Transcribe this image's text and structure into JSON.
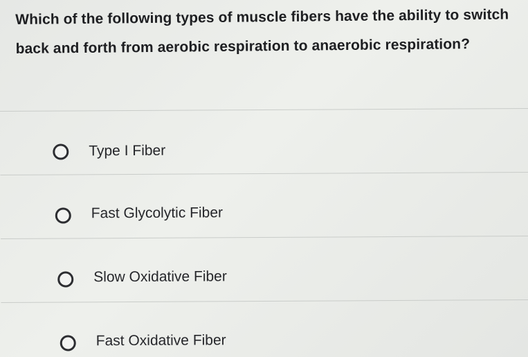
{
  "question": {
    "text": "Which of the following types of muscle fibers have the ability to switch back and forth from aerobic respiration to anaerobic respiration?"
  },
  "options": [
    {
      "label": "Type I Fiber",
      "selected": false
    },
    {
      "label": "Fast Glycolytic Fiber",
      "selected": false
    },
    {
      "label": "Slow Oxidative Fiber",
      "selected": false
    },
    {
      "label": "Fast Oxidative Fiber",
      "selected": false
    }
  ]
}
